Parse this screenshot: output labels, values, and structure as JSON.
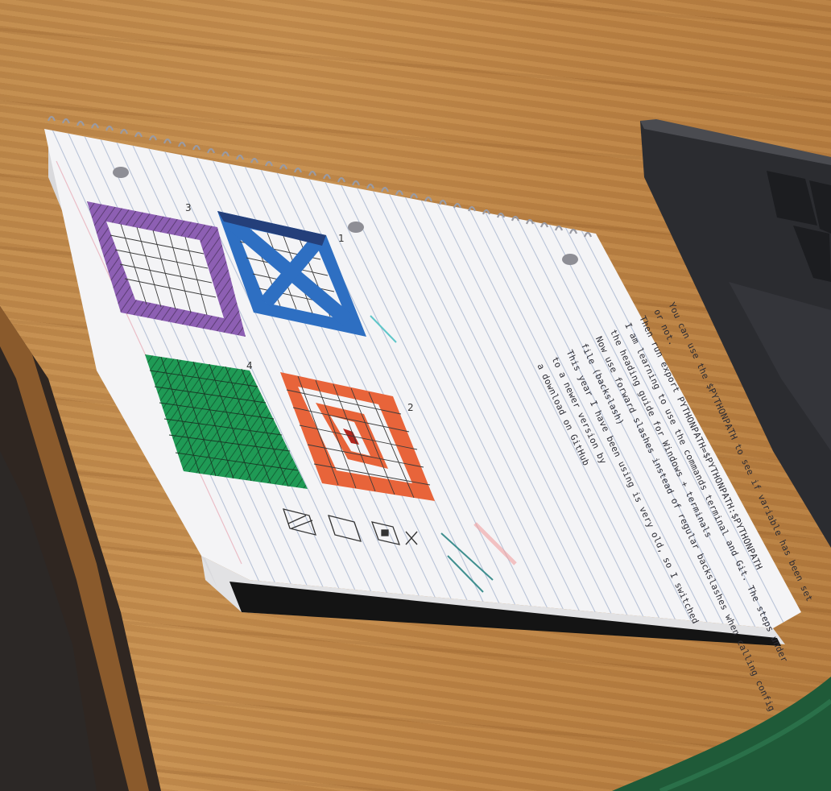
{
  "scene": {
    "description_tag": "photo-notebook-on-desk",
    "colors": {
      "wood": "#c08a4c",
      "paper": "#f4f4f6",
      "rule_line": "#b9c4d8",
      "purple": "#8d5fb3",
      "blue": "#2e6fc2",
      "green": "#1f9a55",
      "orange": "#e8643a",
      "laptop": "#2e2f33",
      "cloth": "#1f5a38"
    }
  },
  "notebook": {
    "grid_numbers": [
      "3",
      "1",
      "4",
      "2"
    ],
    "legend_symbols": [
      "hatched-square-icon",
      "empty-square-icon",
      "dot-square-icon",
      "x-mark-icon"
    ],
    "notes": [
      "You can use the $PYTHONPATH to see if variable has been set",
      "or not.",
      "Then run  export PYTHONPATH=$PYTHONPATH:$PYTHONPATH",
      "I am learning to use the commands terminal and Git. The steps under",
      "the heading guide for Windows + terminals",
      "Now use forward slashes instead of regular backslashes when calling config",
      "file (backslash)",
      "This year I have been using is very old, so I switched",
      "to a newer version by",
      "a download on GitHub"
    ]
  }
}
